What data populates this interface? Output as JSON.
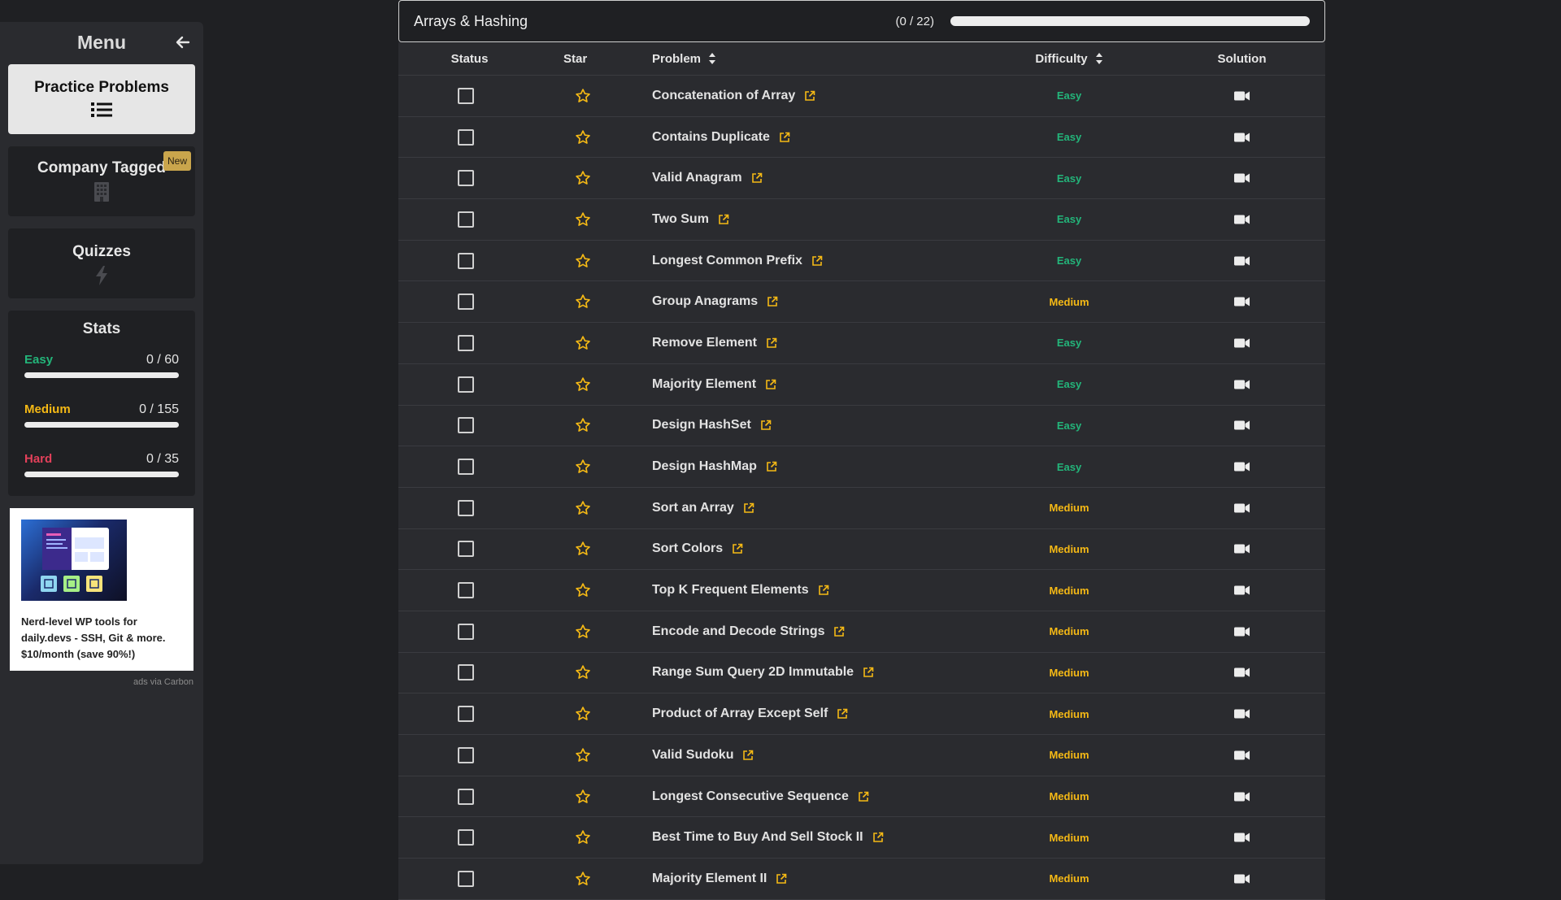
{
  "menu": {
    "title": "Menu",
    "items": [
      {
        "label": "Practice Problems",
        "icon": "list-icon",
        "active": true
      },
      {
        "label": "Company Tagged",
        "icon": "building-icon",
        "badge": "New"
      },
      {
        "label": "Quizzes",
        "icon": "lightning-icon"
      }
    ]
  },
  "stats": {
    "title": "Stats",
    "rows": [
      {
        "name": "Easy",
        "count": "0 / 60",
        "color": "#23b57a",
        "progress": 0
      },
      {
        "name": "Medium",
        "count": "0 / 155",
        "color": "#f5b915",
        "progress": 0
      },
      {
        "name": "Hard",
        "count": "0 / 35",
        "color": "#e2405a",
        "progress": 0
      }
    ]
  },
  "ad": {
    "text": "Nerd-level WP tools for daily.devs - SSH, Git & more. $10/month (save 90%!)",
    "credit": "ads via Carbon"
  },
  "section": {
    "title": "Arrays & Hashing",
    "count": "(0 / 22)",
    "progress": 0
  },
  "table": {
    "headers": {
      "status": "Status",
      "star": "Star",
      "problem": "Problem",
      "difficulty": "Difficulty",
      "solution": "Solution"
    },
    "rows": [
      {
        "problem": "Concatenation of Array",
        "difficulty": "Easy"
      },
      {
        "problem": "Contains Duplicate",
        "difficulty": "Easy"
      },
      {
        "problem": "Valid Anagram",
        "difficulty": "Easy"
      },
      {
        "problem": "Two Sum",
        "difficulty": "Easy"
      },
      {
        "problem": "Longest Common Prefix",
        "difficulty": "Easy"
      },
      {
        "problem": "Group Anagrams",
        "difficulty": "Medium"
      },
      {
        "problem": "Remove Element",
        "difficulty": "Easy"
      },
      {
        "problem": "Majority Element",
        "difficulty": "Easy"
      },
      {
        "problem": "Design HashSet",
        "difficulty": "Easy"
      },
      {
        "problem": "Design HashMap",
        "difficulty": "Easy"
      },
      {
        "problem": "Sort an Array",
        "difficulty": "Medium"
      },
      {
        "problem": "Sort Colors",
        "difficulty": "Medium"
      },
      {
        "problem": "Top K Frequent Elements",
        "difficulty": "Medium"
      },
      {
        "problem": "Encode and Decode Strings",
        "difficulty": "Medium"
      },
      {
        "problem": "Range Sum Query 2D Immutable",
        "difficulty": "Medium"
      },
      {
        "problem": "Product of Array Except Self",
        "difficulty": "Medium"
      },
      {
        "problem": "Valid Sudoku",
        "difficulty": "Medium"
      },
      {
        "problem": "Longest Consecutive Sequence",
        "difficulty": "Medium"
      },
      {
        "problem": "Best Time to Buy And Sell Stock II",
        "difficulty": "Medium"
      },
      {
        "problem": "Majority Element II",
        "difficulty": "Medium"
      }
    ]
  },
  "colors": {
    "easy": "#23b57a",
    "medium": "#f5b915",
    "hard": "#e2405a",
    "star": "#f5b915",
    "link_icon": "#f5b915"
  }
}
